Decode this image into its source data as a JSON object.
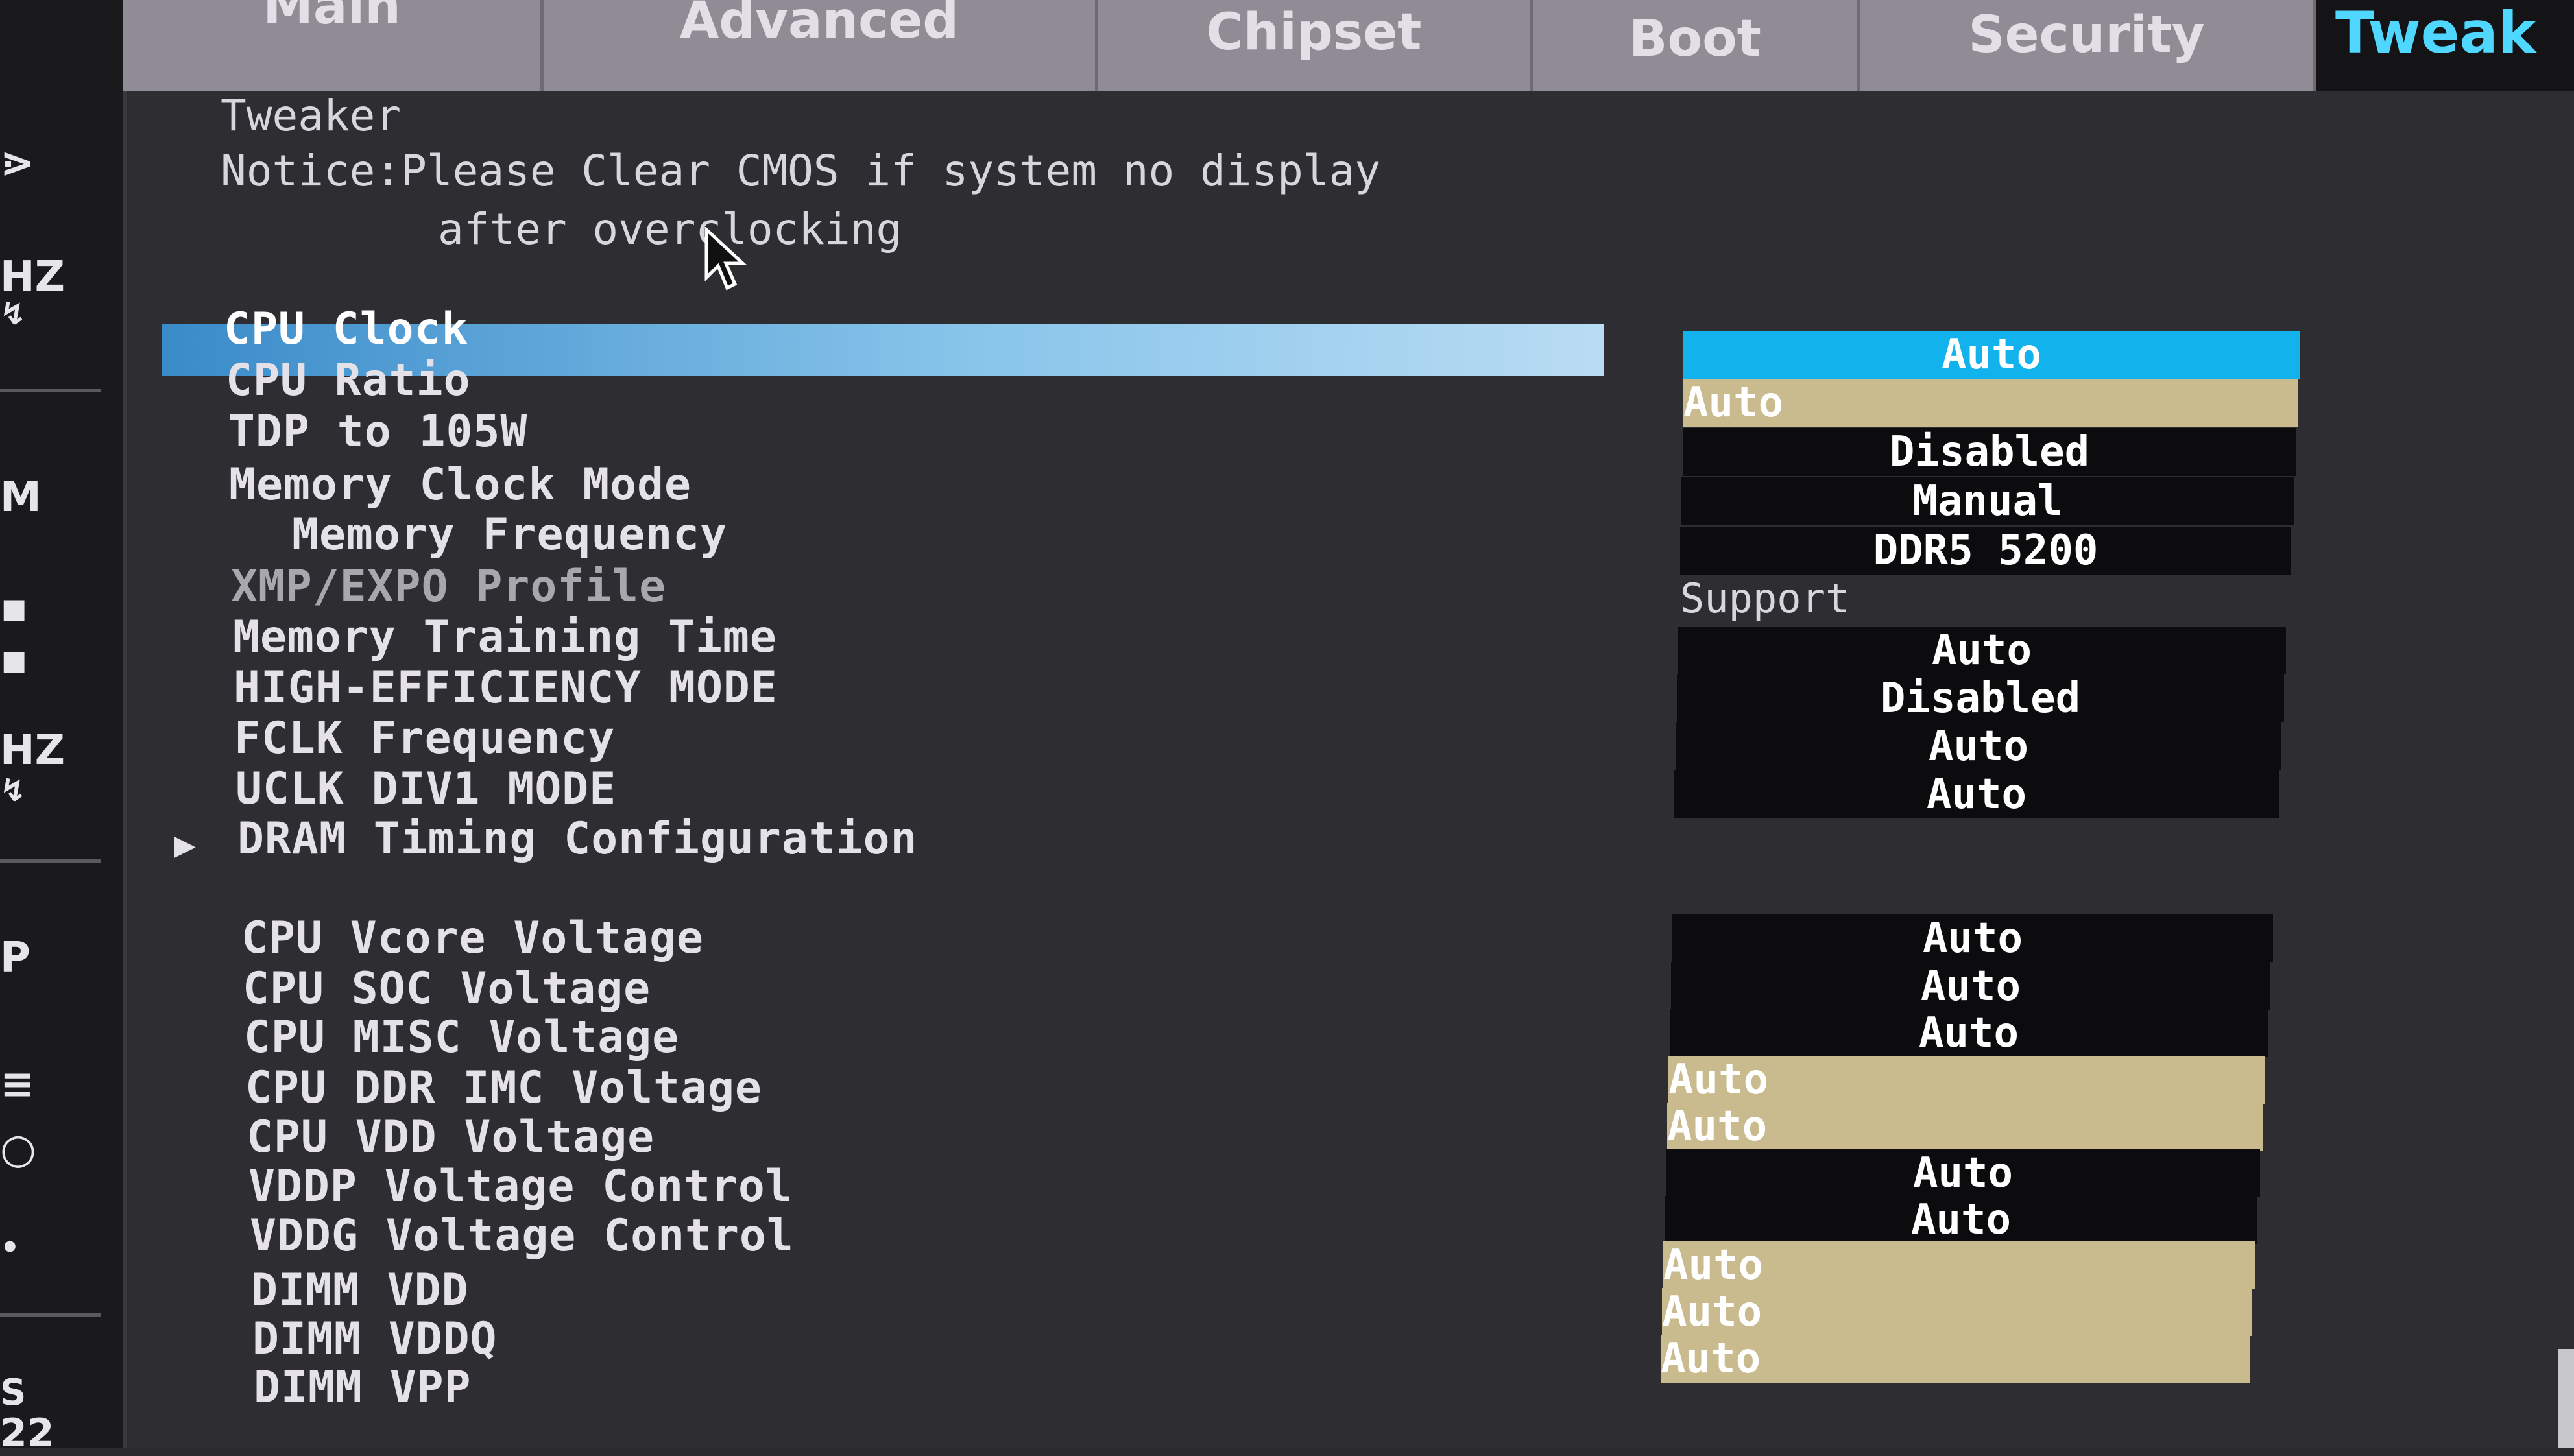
{
  "tabs": [
    {
      "label": "Main"
    },
    {
      "label": "Advanced"
    },
    {
      "label": "Chipset"
    },
    {
      "label": "Boot"
    },
    {
      "label": "Security"
    },
    {
      "label": "Tweak"
    }
  ],
  "left_strip": {
    "fragments": [
      "⋗",
      "HZ",
      "↯",
      "M",
      "▪",
      "▪",
      "HZ",
      "↯",
      "P",
      "≡",
      "○",
      "•",
      "S",
      "22"
    ]
  },
  "header": {
    "title": "Tweaker",
    "notice_line1": "Notice:Please Clear CMOS if system no display",
    "notice_line2": "after overclocking"
  },
  "settings": [
    {
      "label": "CPU Clock"
    },
    {
      "label": "CPU Ratio"
    },
    {
      "label": "TDP to 105W"
    },
    {
      "label": "Memory Clock Mode"
    },
    {
      "label": "Memory Frequency"
    },
    {
      "label": "XMP/EXPO Profile"
    },
    {
      "label": "Memory Training Time"
    },
    {
      "label": "HIGH-EFFICIENCY MODE"
    },
    {
      "label": "FCLK Frequency"
    },
    {
      "label": "UCLK DIV1 MODE"
    },
    {
      "label": "DRAM Timing Configuration"
    },
    {
      "label": "CPU Vcore Voltage"
    },
    {
      "label": "CPU SOC Voltage"
    },
    {
      "label": "CPU MISC Voltage"
    },
    {
      "label": "CPU DDR IMC Voltage"
    },
    {
      "label": "CPU VDD Voltage"
    },
    {
      "label": "VDDP Voltage Control"
    },
    {
      "label": "VDDG Voltage Control"
    },
    {
      "label": "DIMM VDD"
    },
    {
      "label": "DIMM VDDQ"
    },
    {
      "label": "DIMM VPP"
    }
  ],
  "values": [
    "Auto",
    "Auto",
    "Disabled",
    "Manual",
    "DDR5 5200",
    "Support",
    "Auto",
    "Disabled",
    "Auto",
    "Auto",
    "Auto",
    "Auto",
    "Auto",
    "Auto",
    "Auto",
    "Auto",
    "Auto",
    "Auto",
    "Auto",
    "Auto"
  ],
  "colors": {
    "background": "#2e2d32",
    "tab_inactive": "#8f8c96",
    "tab_active_text": "#4fd7ff",
    "selected_value": "#12b3ec",
    "selected_row": "#87c4ea",
    "value_box": "#0c0c0f",
    "value_box_highlight": "#c9bb8e"
  },
  "icons": [
    "mouse-cursor-icon",
    "submenu-arrow-icon"
  ]
}
